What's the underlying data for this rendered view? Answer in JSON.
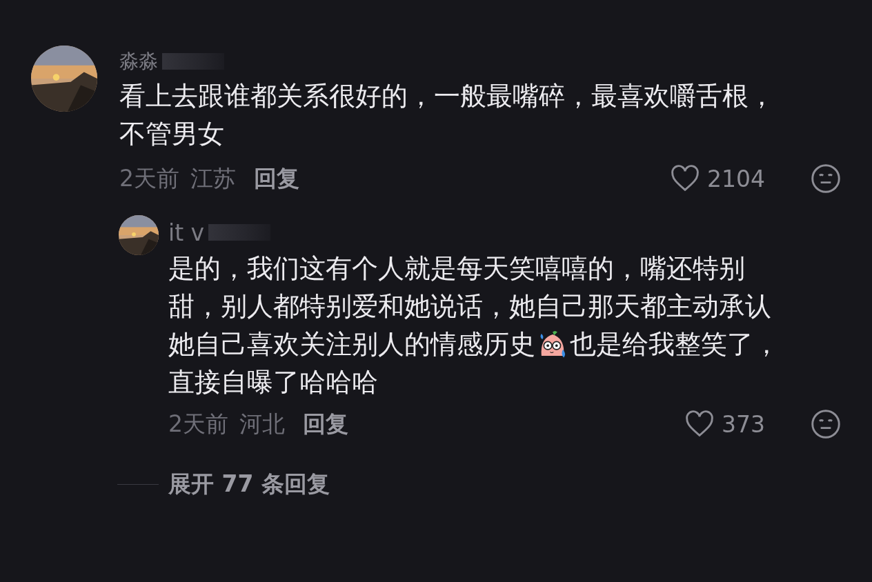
{
  "comments": [
    {
      "name": "淼淼",
      "lines": [
        [
          {
            "kind": "text",
            "text": "看上去跟谁都关系很好的，一般最嘴碎，最喜欢嚼舌根，"
          }
        ],
        [
          {
            "kind": "text",
            "text": "不管男女"
          }
        ]
      ],
      "time": "2天前",
      "location": "江苏",
      "reply_label": "回复",
      "likes": "2104",
      "liked": false,
      "replies": [
        {
          "name": "it v",
          "lines": [
            [
              {
                "kind": "text",
                "text": "是的，我们这有个人就是每天笑嘻嘻的，嘴还特别"
              }
            ],
            [
              {
                "kind": "text",
                "text": "甜，别人都特别爱和她说话，她自己那天都主动承认"
              }
            ],
            [
              {
                "kind": "text",
                "text": "她自己喜欢关注别人的情感历史"
              },
              {
                "kind": "sticker"
              },
              {
                "kind": "text",
                "text": "也是给我整笑了，"
              }
            ],
            [
              {
                "kind": "text",
                "text": "直接自曝了哈哈哈"
              }
            ]
          ],
          "time": "2天前",
          "location": "河北",
          "reply_label": "回复",
          "likes": "373",
          "liked": false
        }
      ],
      "expand": "展开 77 条回复"
    }
  ]
}
